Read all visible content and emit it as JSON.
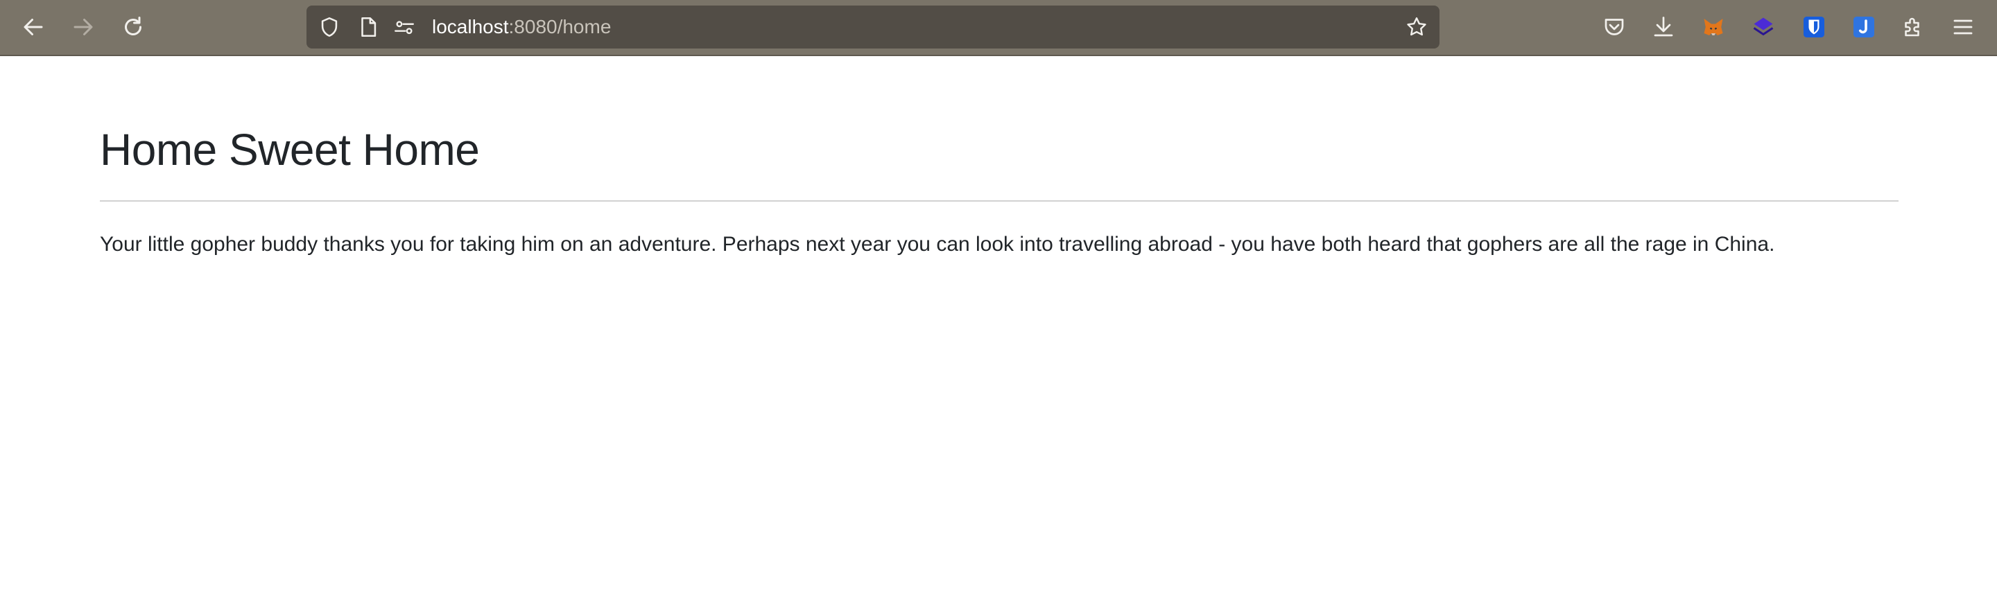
{
  "browser": {
    "url_host": "localhost",
    "url_path": ":8080/home",
    "colors": {
      "toolbar": "#7a7468",
      "urlbar": "#524d46"
    },
    "icons": {
      "back": "back-arrow-icon",
      "forward": "forward-arrow-icon",
      "reload": "reload-icon",
      "shield": "tracking-protection-shield-icon",
      "page": "page-info-icon",
      "permissions": "permissions-icon",
      "bookmark": "bookmark-star-icon",
      "pocket": "pocket-icon",
      "downloads": "downloads-icon",
      "extensions": [
        "metamask-fox-icon",
        "layers-extension-icon",
        "bitwarden-shield-icon",
        "ext-j-icon"
      ],
      "puzzle": "extensions-puzzle-icon",
      "menu": "hamburger-menu-icon"
    }
  },
  "page": {
    "title": "Home Sweet Home",
    "body": "Your little gopher buddy thanks you for taking him on an adventure. Perhaps next year you can look into travelling abroad - you have both heard that gophers are all the rage in China."
  }
}
